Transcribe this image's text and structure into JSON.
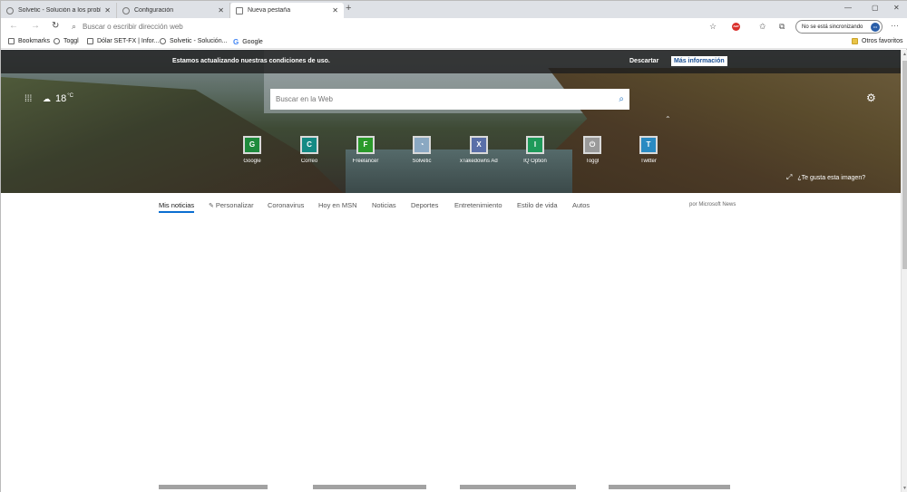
{
  "tabs": [
    {
      "title": "Solvetic - Solución a los problem",
      "active": false
    },
    {
      "title": "Configuración",
      "active": false
    },
    {
      "title": "Nueva pestaña",
      "active": true
    }
  ],
  "window_controls": {
    "minimize": "—",
    "maximize": "▢",
    "close": "✕"
  },
  "address_bar": {
    "placeholder": "Buscar o escribir dirección web"
  },
  "toolbar": {
    "sync_label": "No se está sincronizando",
    "more": "···",
    "abp": "ABP"
  },
  "bookmarks": [
    {
      "label": "Bookmarks",
      "icon": "bookmark-icon"
    },
    {
      "label": "Toggl",
      "icon": "toggl-icon"
    },
    {
      "label": "Dólar SET-FX | Infor...",
      "icon": "page-icon"
    },
    {
      "label": "Solvetic - Solución...",
      "icon": "solvetic-icon"
    },
    {
      "label": "Google",
      "icon": "google-icon"
    }
  ],
  "other_favorites": "Otros favoritos",
  "notice": {
    "message": "Estamos actualizando nuestras condiciones de uso.",
    "dismiss": "Descartar",
    "more": "Más información"
  },
  "weather": {
    "temp": "18",
    "unit": "°C"
  },
  "search": {
    "placeholder": "Buscar en la Web"
  },
  "tiles": [
    {
      "letter": "G",
      "label": "Google",
      "color": "#1e8a3c"
    },
    {
      "letter": "C",
      "label": "Correo",
      "color": "#148a84"
    },
    {
      "letter": "F",
      "label": "Freelancer",
      "color": "#2a9a2a"
    },
    {
      "letter": "",
      "label": "Solvetic",
      "color": "#8aa8c2"
    },
    {
      "letter": "X",
      "label": "xTakedowns Ad...",
      "color": "#5a6fa8"
    },
    {
      "letter": "I",
      "label": "IQ Option",
      "color": "#1e9a5a"
    },
    {
      "letter": "⏻",
      "label": "Toggl",
      "color": "#9a9a9a"
    },
    {
      "letter": "T",
      "label": "Twitter",
      "color": "#2a8ac2"
    }
  ],
  "image_prompt": "¿Te gusta esta imagen?",
  "news_nav": [
    {
      "label": "Mis noticias"
    },
    {
      "label": "Personalizar"
    },
    {
      "label": "Coronavirus"
    },
    {
      "label": "Hoy en MSN"
    },
    {
      "label": "Noticias"
    },
    {
      "label": "Deportes"
    },
    {
      "label": "Entretenimiento"
    },
    {
      "label": "Estilo de vida"
    },
    {
      "label": "Autos"
    }
  ],
  "powered_by": "por Microsoft News",
  "colors": {
    "accent": "#0a6ed1",
    "notice_bg": "#1e1e1e",
    "link_blue": "#1a4f93"
  }
}
